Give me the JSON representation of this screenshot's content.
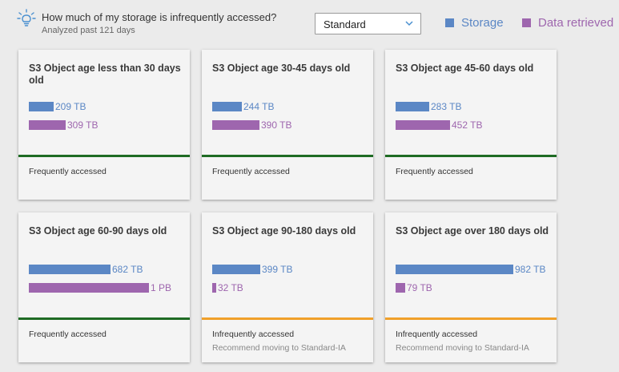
{
  "header": {
    "title": "How much of my storage is infrequently accessed?",
    "subtitle": "Analyzed past 121 days"
  },
  "storage_class_select": {
    "value": "Standard"
  },
  "legend": {
    "storage": "Storage",
    "retrieved": "Data retrieved"
  },
  "colors": {
    "storage": "#5b87c5",
    "retrieved": "#9e66ae",
    "frequent": "#1f6b24",
    "infrequent": "#f0a02a"
  },
  "cards": [
    {
      "title": "S3 Object age less than 30 days old",
      "storage_label": "209 TB",
      "storage_value_tb": 209,
      "retrieved_label": "309 TB",
      "retrieved_value_tb": 309,
      "status": "Frequently accessed",
      "recommendation": ""
    },
    {
      "title": "S3 Object age 30-45 days old",
      "storage_label": "244 TB",
      "storage_value_tb": 244,
      "retrieved_label": "390 TB",
      "retrieved_value_tb": 390,
      "status": "Frequently accessed",
      "recommendation": ""
    },
    {
      "title": "S3 Object age 45-60 days old",
      "storage_label": "283 TB",
      "storage_value_tb": 283,
      "retrieved_label": "452 TB",
      "retrieved_value_tb": 452,
      "status": "Frequently accessed",
      "recommendation": ""
    },
    {
      "title": "S3 Object age 60-90 days old",
      "storage_label": "682 TB",
      "storage_value_tb": 682,
      "retrieved_label": "1 PB",
      "retrieved_value_tb": 1000,
      "status": "Frequently accessed",
      "recommendation": ""
    },
    {
      "title": "S3 Object age 90-180 days old",
      "storage_label": "399 TB",
      "storage_value_tb": 399,
      "retrieved_label": "32 TB",
      "retrieved_value_tb": 32,
      "status": "Infrequently accessed",
      "recommendation": "Recommend moving to Standard-IA"
    },
    {
      "title": "S3 Object age over 180 days old",
      "storage_label": "982 TB",
      "storage_value_tb": 982,
      "retrieved_label": "79 TB",
      "retrieved_value_tb": 79,
      "status": "Infrequently accessed",
      "recommendation": "Recommend moving to Standard-IA"
    }
  ]
}
